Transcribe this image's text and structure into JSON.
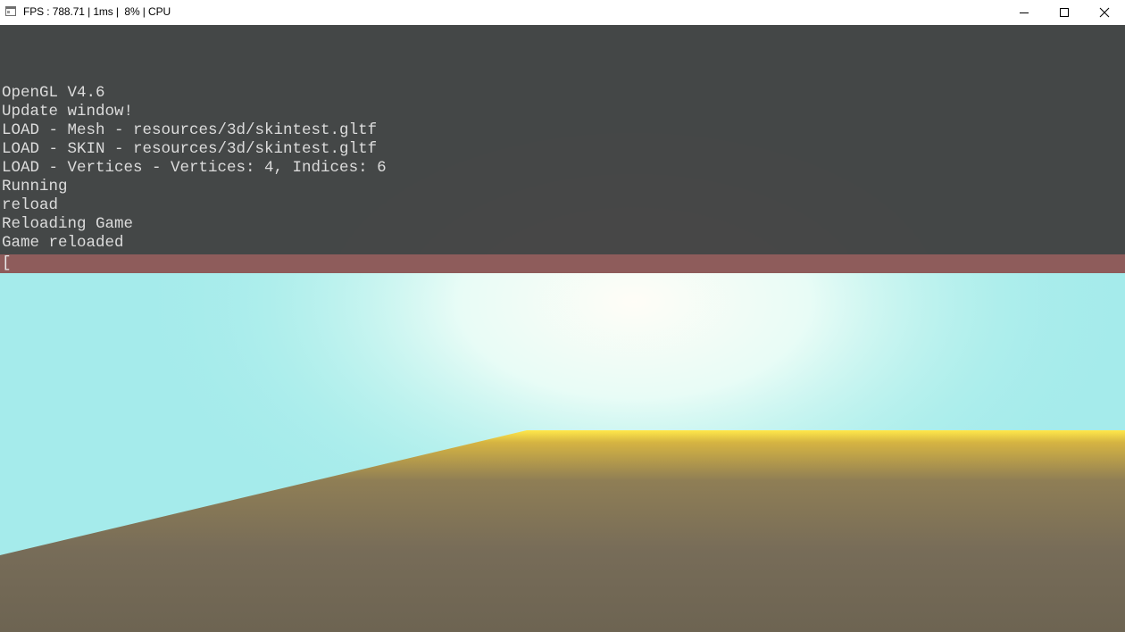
{
  "window": {
    "title": "FPS : 788.71 | 1ms |  8% | CPU",
    "icon": "app-window-icon",
    "controls": [
      "minimize-icon",
      "maximize-icon",
      "close-icon"
    ]
  },
  "console": {
    "lines": [
      "OpenGL V4.6",
      "Update window!",
      "LOAD - Mesh - resources/3d/skintest.gltf",
      "LOAD - SKIN - resources/3d/skintest.gltf",
      "LOAD - Vertices - Vertices: 4, Indices: 6",
      "Running",
      "reload",
      "Reloading Game",
      "Game reloaded"
    ],
    "input_value": "[",
    "colors": {
      "background": "#404040",
      "text": "#dcdcdc",
      "input_bar": "#8e5c5b"
    }
  },
  "scene": {
    "sky_color": "#a5ebeb",
    "sun_glow_color": "#fffdf7",
    "horizon_glow_color": "#ffe84a",
    "ground_color": "#776c58"
  }
}
